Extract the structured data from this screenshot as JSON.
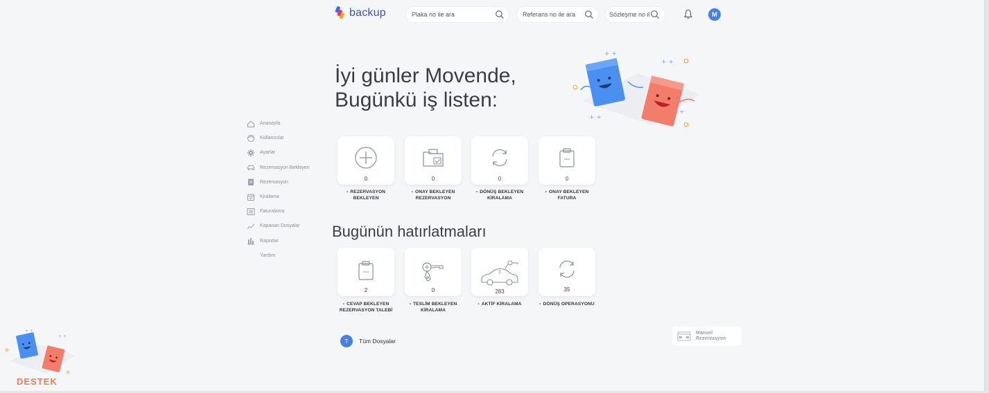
{
  "header": {
    "logo_text": "backup",
    "search_plate_placeholder": "Plaka no ile ara",
    "search_reference_placeholder": "Referans no ile ara",
    "search_contract_placeholder": "Sözleşme no ile ara",
    "avatar_initial": "M"
  },
  "sidebar": {
    "items": [
      {
        "label": "Anasayfa",
        "icon": "home-icon"
      },
      {
        "label": "Kullanıcılar",
        "icon": "user-face-icon"
      },
      {
        "label": "Ayarlar",
        "icon": "gear-icon"
      },
      {
        "label": "Rezervasyon Bekleyen",
        "icon": "car-icon"
      },
      {
        "label": "Rezervasyon",
        "icon": "clipboard-icon"
      },
      {
        "label": "Kiralama",
        "icon": "calendar-check-icon"
      },
      {
        "label": "Faturalama",
        "icon": "invoice-icon"
      },
      {
        "label": "Kapanan Dosyalar",
        "icon": "trend-icon"
      },
      {
        "label": "Raporlar",
        "icon": "bar-chart-icon"
      },
      {
        "label": "Yardım",
        "icon": ""
      }
    ]
  },
  "main": {
    "greeting_line1": "İyi günler Movende,",
    "greeting_line2": "Bugünkü iş listen:",
    "task_cards": [
      {
        "count": "0",
        "label_line1": "REZERVASYON",
        "label_line2": "BEKLEYEN",
        "icon": "plus-circle-icon"
      },
      {
        "count": "0",
        "label_line1": "ONAY BEKLEYEN",
        "label_line2": "REZERVASYON",
        "icon": "folder-check-icon"
      },
      {
        "count": "0",
        "label_line1": "DÖNÜŞ BEKLEYEN",
        "label_line2": "KİRALAMA",
        "icon": "refresh-icon"
      },
      {
        "count": "0",
        "label_line1": "ONAY BEKLEYEN",
        "label_line2": "FATURA",
        "icon": "clipboard-dots-icon"
      }
    ],
    "reminders_title": "Bugünün hatırlatmaları",
    "reminder_cards": [
      {
        "count": "2",
        "label_line1": "CEVAP BEKLEYEN",
        "label_line2": "REZERVASYON TALEBİ",
        "icon": "clipboard-dots-icon"
      },
      {
        "count": "0",
        "label_line1": "TESLİM BEKLEYEN",
        "label_line2": "KİRALAMA",
        "icon": "car-keys-icon"
      },
      {
        "count": "283",
        "label_line1": "AKTİF KİRALAMA",
        "label_line2": "",
        "icon": "car-with-keys-icon"
      },
      {
        "count": "35",
        "label_line1": "DÖNÜŞ OPERASYONU",
        "label_line2": "",
        "icon": "refresh-icon"
      }
    ],
    "all_files_badge": "T",
    "all_files_label": "Tüm Dosyalar",
    "manual_line1": "Manuel",
    "manual_line2": "Rezervasyon"
  },
  "support": {
    "label": "DESTEK"
  },
  "colors": {
    "accent": "#4a7fe0",
    "support": "#f07a5c",
    "background": "#f5f6f8"
  }
}
